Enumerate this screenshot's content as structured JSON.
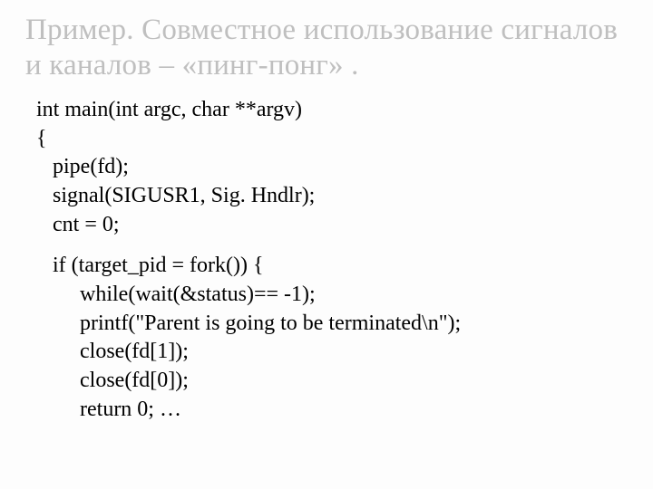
{
  "title": "Пример. Совместное использование сигналов и каналов – «пинг-понг» .",
  "code": {
    "block1": "int main(int argc, char **argv)\n{\n   pipe(fd);\n   signal(SIGUSR1, Sig. Hndlr);\n   cnt = 0;",
    "block2": "   if (target_pid = fork()) {\n        while(wait(&status)== -1);\n        printf(\"Parent is going to be terminated\\n\");\n        close(fd[1]);\n        close(fd[0]);\n        return 0; …"
  }
}
